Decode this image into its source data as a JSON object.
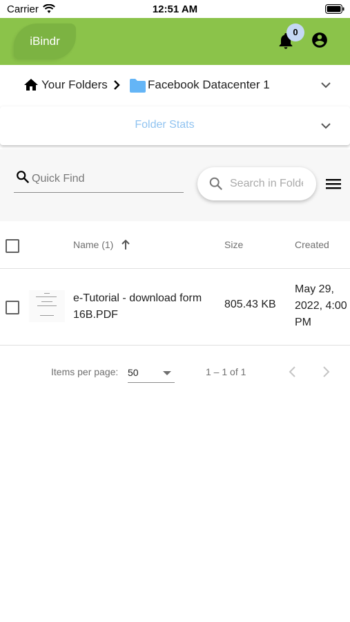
{
  "status_bar": {
    "carrier": "Carrier",
    "time": "12:51 AM"
  },
  "app_bar": {
    "logo": "iBindr",
    "notification_count": "0"
  },
  "breadcrumb": {
    "root": "Your Folders",
    "current": "Facebook Datacenter 1"
  },
  "folder_stats": {
    "title": "Folder Stats"
  },
  "toolbar": {
    "quick_find_placeholder": "Quick Find",
    "search_placeholder": "Search in Folder"
  },
  "table": {
    "headers": {
      "name": "Name (1)",
      "size": "Size",
      "created": "Created"
    },
    "rows": [
      {
        "name": "e-Tutorial - download form 16B.PDF",
        "size": "805.43 KB",
        "created": "May 29, 2022, 4:00 PM"
      }
    ]
  },
  "paginator": {
    "items_per_page_label": "Items per page:",
    "page_size": "50",
    "range": "1 – 1 of 1"
  },
  "colors": {
    "app_bar": "#8bc34a",
    "logo_bg": "#7cb342",
    "badge": "#c5d8f5",
    "folder_icon": "#64b5f6",
    "stats_title": "#90c3f0"
  },
  "icons": [
    "wifi-icon",
    "battery-icon",
    "bell-icon",
    "account-icon",
    "home-icon",
    "chevron-right-icon",
    "folder-icon",
    "chevron-down-icon",
    "search-icon",
    "menu-icon",
    "arrow-up-icon",
    "chevron-left-icon"
  ]
}
